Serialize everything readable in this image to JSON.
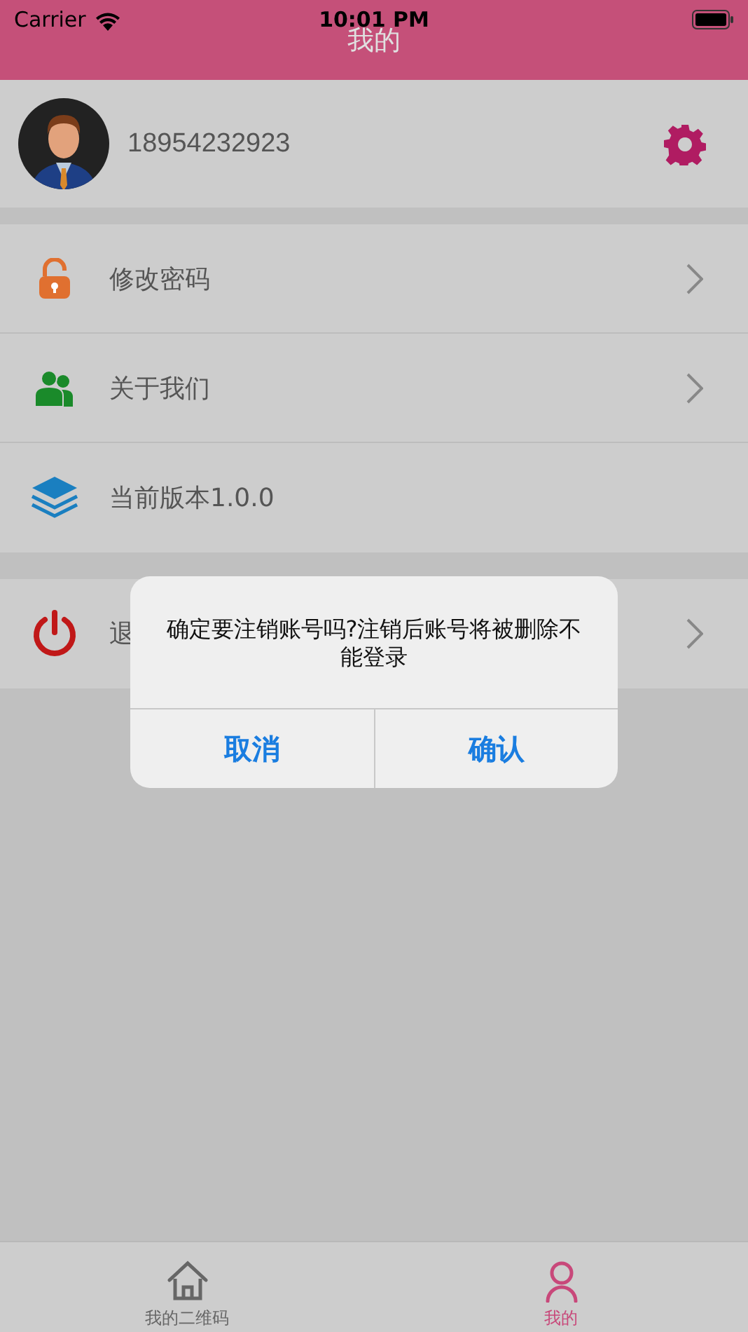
{
  "status_bar": {
    "carrier": "Carrier",
    "time": "10:01 PM"
  },
  "nav_bar": {
    "title": "我的"
  },
  "profile": {
    "phone": "18954232923"
  },
  "menu_groups": [
    {
      "items": [
        {
          "label": "修改密码",
          "chevron": true
        },
        {
          "label": "关于我们",
          "chevron": true
        },
        {
          "label": "当前版本1.0.0",
          "chevron": false
        }
      ]
    },
    {
      "items": [
        {
          "label": "退",
          "chevron": true
        }
      ]
    }
  ],
  "dialog": {
    "message": "确定要注销账号吗?注销后账号将被删除不能登录",
    "buttons": [
      "取消",
      "确认"
    ]
  },
  "tab_bar": [
    {
      "label": "我的二维码",
      "selected": false
    },
    {
      "label": "我的",
      "selected": true
    }
  ]
}
